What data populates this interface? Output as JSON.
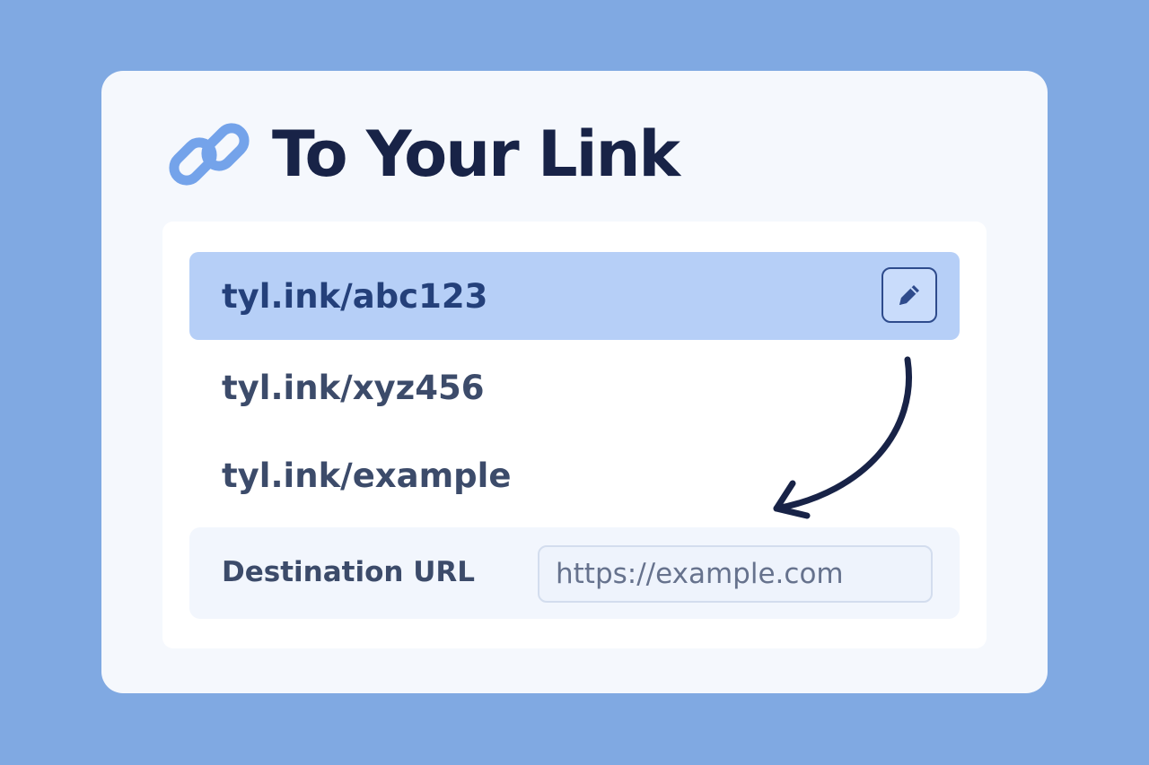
{
  "header": {
    "title": "To Your Link",
    "icon": "link-icon"
  },
  "links": [
    {
      "label": "tyl.ink/abc123",
      "selected": true
    },
    {
      "label": "tyl.ink/xyz456",
      "selected": false
    },
    {
      "label": "tyl.ink/example",
      "selected": false
    }
  ],
  "edit_button": {
    "icon": "pencil-icon"
  },
  "destination": {
    "label": "Destination URL",
    "placeholder": "https://example.com",
    "value": ""
  },
  "colors": {
    "background": "#80a9e2",
    "card": "#f5f8fd",
    "title": "#182347",
    "selected_row": "#b6cff7",
    "accent": "#2e4b8c",
    "link_icon": "#74a3ea"
  }
}
